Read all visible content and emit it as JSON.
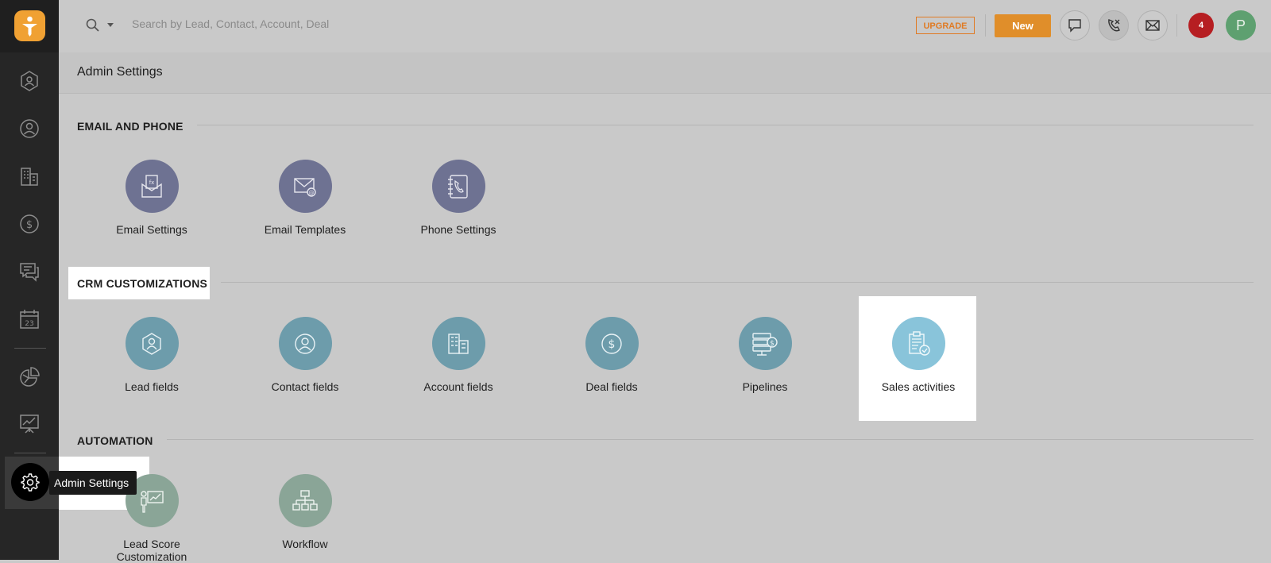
{
  "search": {
    "placeholder": "Search by Lead, Contact, Account, Deal"
  },
  "topbar": {
    "upgrade_label": "UPGRADE",
    "new_label": "New",
    "notification_count": "4",
    "avatar_initial": "P",
    "icons": [
      "search-icon",
      "chevron-down-icon",
      "chat-icon",
      "phone-off-icon",
      "mail-icon"
    ]
  },
  "sidebar": {
    "items": [
      {
        "name": "leads",
        "icon": "lead-icon"
      },
      {
        "name": "contacts",
        "icon": "contact-icon"
      },
      {
        "name": "accounts",
        "icon": "building-icon"
      },
      {
        "name": "deals",
        "icon": "dollar-icon"
      },
      {
        "name": "conversations",
        "icon": "chat-icon"
      },
      {
        "name": "calendar",
        "icon": "calendar-icon",
        "text": "23"
      },
      {
        "name": "reports",
        "icon": "pie-chart-icon"
      },
      {
        "name": "analytics",
        "icon": "presentation-icon"
      },
      {
        "name": "admin-settings",
        "icon": "gear-icon"
      }
    ],
    "tooltip": "Admin Settings"
  },
  "page": {
    "title": "Admin Settings"
  },
  "sections": {
    "email_phone": {
      "title": "EMAIL AND PHONE",
      "items": [
        {
          "label": "Email Settings",
          "icon": "email-settings-icon"
        },
        {
          "label": "Email Templates",
          "icon": "email-template-icon"
        },
        {
          "label": "Phone Settings",
          "icon": "phone-book-icon"
        }
      ]
    },
    "crm": {
      "title": "CRM CUSTOMIZATIONS",
      "items": [
        {
          "label": "Lead fields",
          "icon": "lead-icon"
        },
        {
          "label": "Contact fields",
          "icon": "contact-icon"
        },
        {
          "label": "Account fields",
          "icon": "building-icon"
        },
        {
          "label": "Deal fields",
          "icon": "dollar-icon"
        },
        {
          "label": "Pipelines",
          "icon": "pipeline-icon"
        },
        {
          "label": "Sales activities",
          "icon": "clipboard-check-icon"
        }
      ]
    },
    "automation": {
      "title": "AUTOMATION",
      "items": [
        {
          "label": "Lead Score Customization",
          "icon": "lead-score-icon"
        },
        {
          "label": "Workflow",
          "icon": "workflow-icon"
        }
      ]
    }
  },
  "colors": {
    "email_phone_circle": "#6e7292",
    "crm_circle": "#6d9cab",
    "sales_activity_circle": "#89c4da",
    "automation_circle": "#8aa597",
    "brand_orange": "#f0a133"
  }
}
